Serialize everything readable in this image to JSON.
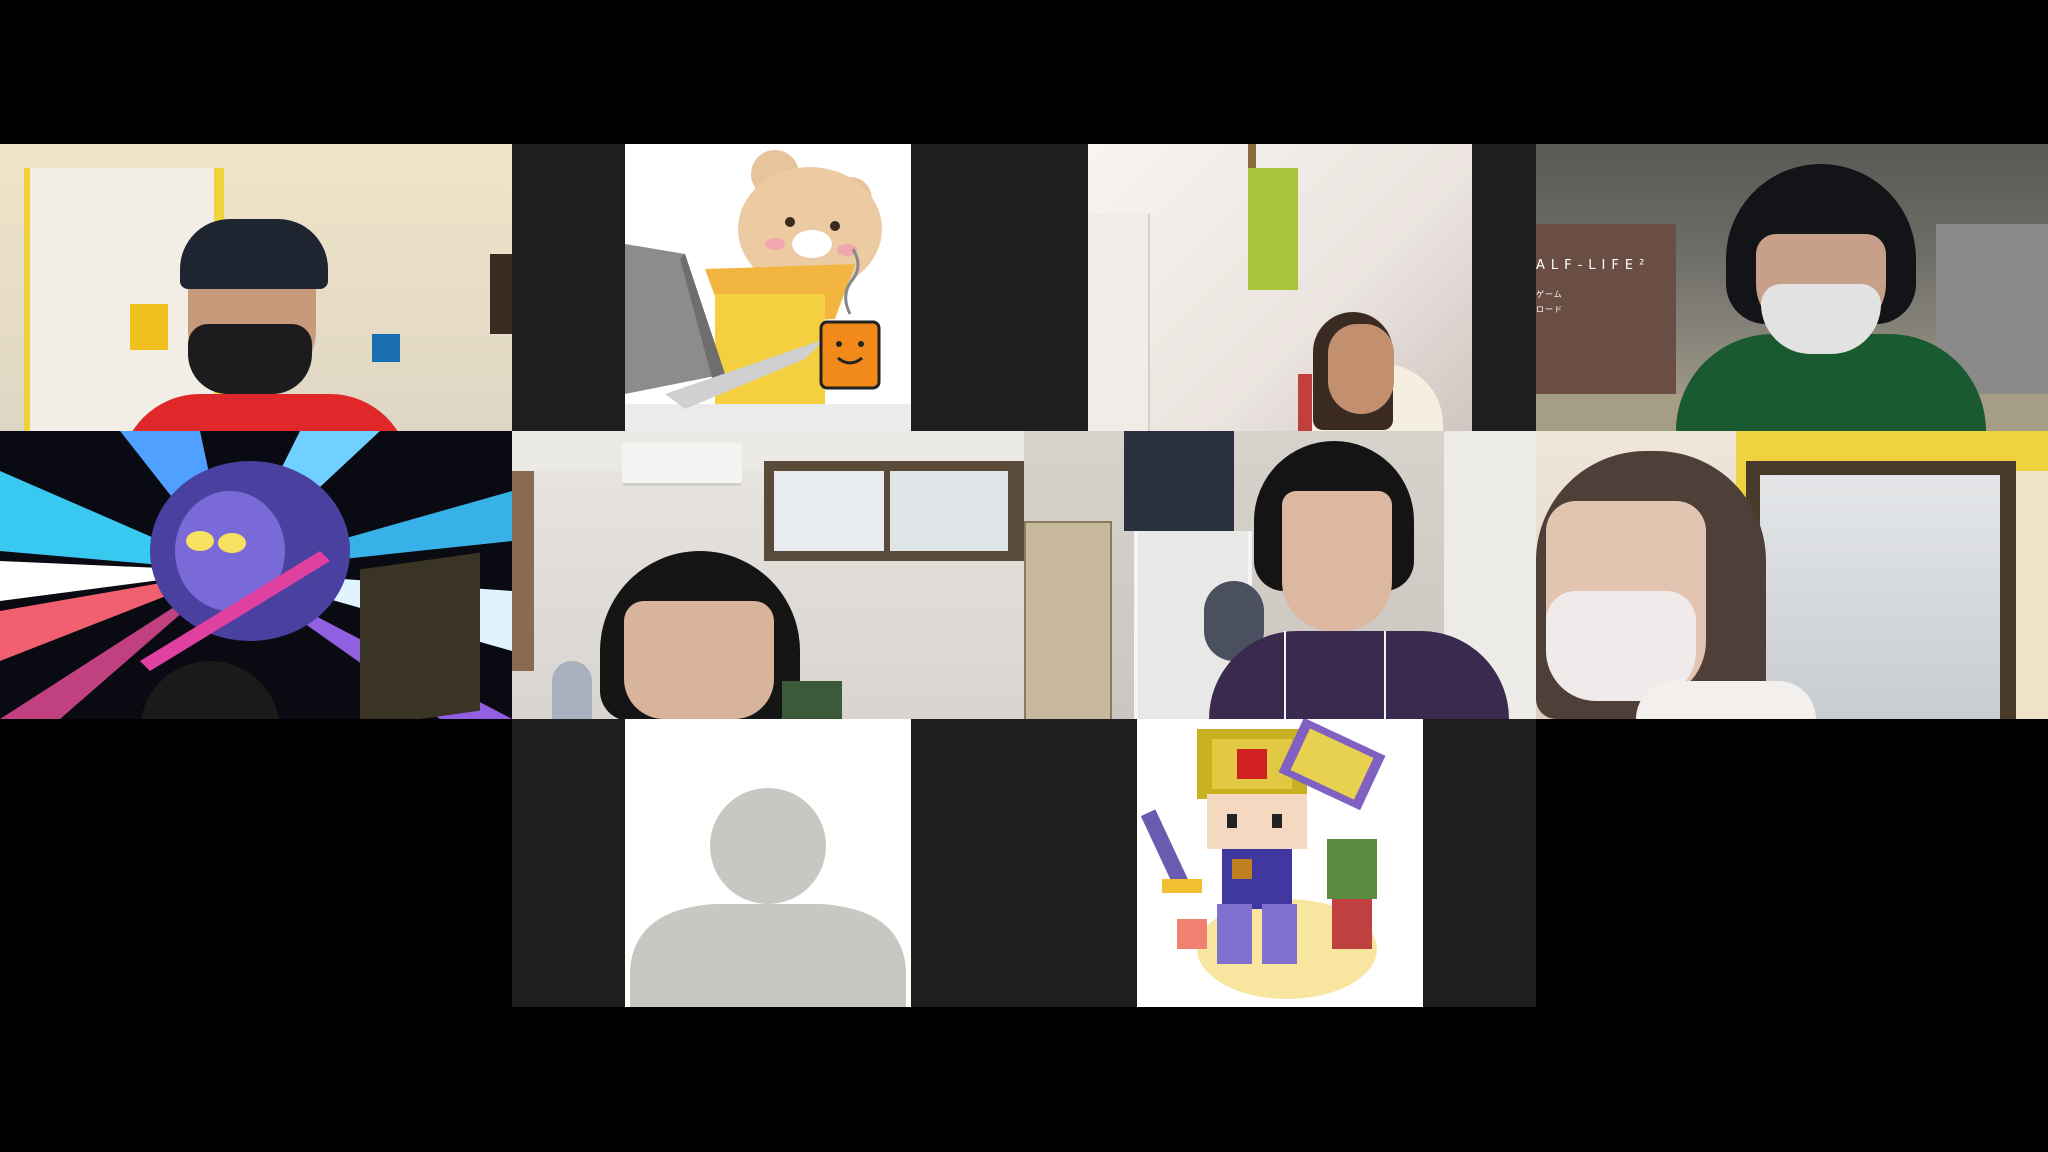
{
  "meeting": {
    "layout": "gallery-view",
    "participants": [
      {
        "id": "p1",
        "video": "on",
        "scene": "man-with-cap-and-mask"
      },
      {
        "id": "p2",
        "video": "off",
        "avatar": "bear-with-laptop-icon"
      },
      {
        "id": "p3",
        "video": "on",
        "scene": "woman-smiling"
      },
      {
        "id": "p4",
        "video": "on",
        "scene": "child-with-game-background"
      },
      {
        "id": "p5",
        "video": "on",
        "scene": "knight-character-background"
      },
      {
        "id": "p6",
        "video": "on",
        "scene": "boy-in-room"
      },
      {
        "id": "p7",
        "video": "on",
        "scene": "girl-with-earphones"
      },
      {
        "id": "p8",
        "video": "on",
        "scene": "woman-with-mask"
      },
      {
        "id": "p9",
        "video": "off",
        "avatar": "default-person-icon"
      },
      {
        "id": "p10",
        "video": "off",
        "avatar": "pixel-hero-icon"
      }
    ]
  },
  "overlays": {
    "game_title": "ALF-LIFE²",
    "game_sub1": "ゲーム",
    "game_sub2": "ロード"
  },
  "colors": {
    "background": "#000000",
    "tile_dark": "#1e1e1e",
    "red_hoodie": "#e0282a",
    "green_note": "#a8c43a"
  }
}
